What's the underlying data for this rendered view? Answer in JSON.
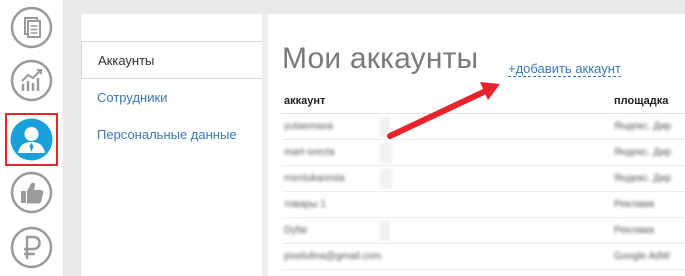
{
  "rail": {
    "items": [
      {
        "icon": "documents-icon"
      },
      {
        "icon": "analytics-chart-icon"
      },
      {
        "icon": "user-profile-icon",
        "active": true
      },
      {
        "icon": "thumbs-up-icon"
      },
      {
        "icon": "ruble-icon"
      }
    ]
  },
  "nav": {
    "items": [
      {
        "label": "Аккаунты",
        "active": true
      },
      {
        "label": "Сотрудники"
      },
      {
        "label": "Персональные данные"
      }
    ]
  },
  "main": {
    "title": "Мои аккаунты",
    "add_link": "+добавить аккаунт",
    "columns": {
      "account": "аккаунт",
      "platform": "площадка"
    },
    "rows": [
      {
        "login": "yutaemaxa",
        "platform": "Яндекс. Дир"
      },
      {
        "login": "mart-srecta",
        "platform": "Яндекс. Дир"
      },
      {
        "login": "mentukaresta",
        "platform": "Яндекс. Дир"
      },
      {
        "login": "товары 1",
        "platform": "Реклама"
      },
      {
        "login": "Dyfar",
        "platform": "Реклама"
      },
      {
        "login": "pixelulina@gmail.com",
        "platform": "Google AdW"
      }
    ]
  },
  "colors": {
    "accent": "#1aa0d8",
    "link": "#3a78b8",
    "highlight": "#e8232b",
    "icon_gray": "#9a9a9a"
  }
}
